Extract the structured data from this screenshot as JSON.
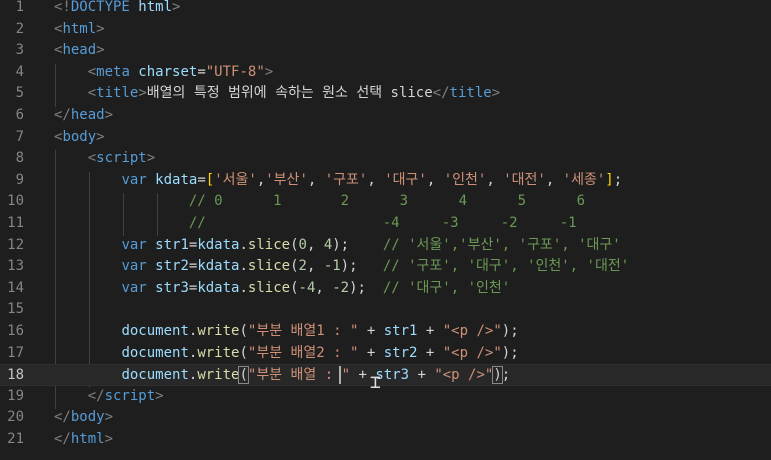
{
  "editor": {
    "current_line": 18,
    "lines": [
      {
        "n": "1",
        "segs": [
          [
            "<!",
            "t-punct"
          ],
          [
            "DOCTYPE",
            "t-tag"
          ],
          [
            " html",
            "t-attr"
          ],
          [
            ">",
            "t-punct"
          ]
        ]
      },
      {
        "n": "2",
        "segs": [
          [
            "<",
            "t-punct"
          ],
          [
            "html",
            "t-tag"
          ],
          [
            ">",
            "t-punct"
          ]
        ]
      },
      {
        "n": "3",
        "segs": [
          [
            "<",
            "t-punct"
          ],
          [
            "head",
            "t-tag"
          ],
          [
            ">",
            "t-punct"
          ]
        ]
      },
      {
        "n": "4",
        "segs": [
          [
            "    ",
            "t-text"
          ],
          [
            "<",
            "t-punct"
          ],
          [
            "meta",
            "t-tag"
          ],
          [
            " charset",
            "t-attr"
          ],
          [
            "=",
            "t-text"
          ],
          [
            "\"UTF-8\"",
            "t-str"
          ],
          [
            ">",
            "t-punct"
          ]
        ]
      },
      {
        "n": "5",
        "segs": [
          [
            "    ",
            "t-text"
          ],
          [
            "<",
            "t-punct"
          ],
          [
            "title",
            "t-tag"
          ],
          [
            ">",
            "t-punct"
          ],
          [
            "배열의 특정 범위에 속하는 원소 선택 slice",
            "t-text"
          ],
          [
            "</",
            "t-punct"
          ],
          [
            "title",
            "t-tag"
          ],
          [
            ">",
            "t-punct"
          ]
        ]
      },
      {
        "n": "6",
        "segs": [
          [
            "</",
            "t-punct"
          ],
          [
            "head",
            "t-tag"
          ],
          [
            ">",
            "t-punct"
          ]
        ]
      },
      {
        "n": "7",
        "segs": [
          [
            "<",
            "t-punct"
          ],
          [
            "body",
            "t-tag"
          ],
          [
            ">",
            "t-punct"
          ]
        ]
      },
      {
        "n": "8",
        "segs": [
          [
            "    ",
            "t-text"
          ],
          [
            "<",
            "t-punct"
          ],
          [
            "script",
            "t-tag"
          ],
          [
            ">",
            "t-punct"
          ]
        ]
      },
      {
        "n": "9",
        "segs": [
          [
            "        ",
            "t-text"
          ],
          [
            "var",
            "t-kw"
          ],
          [
            " kdata",
            "t-var"
          ],
          [
            "=",
            "t-text"
          ],
          [
            "[",
            "t-bracket"
          ],
          [
            "'서울'",
            "t-str"
          ],
          [
            ",",
            "t-text"
          ],
          [
            "'부산'",
            "t-str"
          ],
          [
            ", ",
            "t-text"
          ],
          [
            "'구포'",
            "t-str"
          ],
          [
            ", ",
            "t-text"
          ],
          [
            "'대구'",
            "t-str"
          ],
          [
            ", ",
            "t-text"
          ],
          [
            "'인천'",
            "t-str"
          ],
          [
            ", ",
            "t-text"
          ],
          [
            "'대전'",
            "t-str"
          ],
          [
            ", ",
            "t-text"
          ],
          [
            "'세종'",
            "t-str"
          ],
          [
            "]",
            "t-bracket"
          ],
          [
            ";",
            "t-text"
          ]
        ]
      },
      {
        "n": "10",
        "segs": [
          [
            "                ",
            "t-text"
          ],
          [
            "// 0      1       2      3      4      5      6",
            "t-cmt"
          ]
        ]
      },
      {
        "n": "11",
        "segs": [
          [
            "                ",
            "t-text"
          ],
          [
            "//                     -4     -3     -2     -1",
            "t-cmt"
          ]
        ]
      },
      {
        "n": "12",
        "segs": [
          [
            "        ",
            "t-text"
          ],
          [
            "var",
            "t-kw"
          ],
          [
            " str1",
            "t-var"
          ],
          [
            "=",
            "t-text"
          ],
          [
            "kdata",
            "t-var"
          ],
          [
            ".",
            "t-text"
          ],
          [
            "slice",
            "t-fn"
          ],
          [
            "(",
            "t-text"
          ],
          [
            "0",
            "t-num"
          ],
          [
            ", ",
            "t-text"
          ],
          [
            "4",
            "t-num"
          ],
          [
            ");",
            "t-text"
          ],
          [
            "    ",
            "t-text"
          ],
          [
            "// '서울','부산', '구포', '대구'",
            "t-cmt"
          ]
        ]
      },
      {
        "n": "13",
        "segs": [
          [
            "        ",
            "t-text"
          ],
          [
            "var",
            "t-kw"
          ],
          [
            " str2",
            "t-var"
          ],
          [
            "=",
            "t-text"
          ],
          [
            "kdata",
            "t-var"
          ],
          [
            ".",
            "t-text"
          ],
          [
            "slice",
            "t-fn"
          ],
          [
            "(",
            "t-text"
          ],
          [
            "2",
            "t-num"
          ],
          [
            ", ",
            "t-text"
          ],
          [
            "-1",
            "t-num"
          ],
          [
            ");",
            "t-text"
          ],
          [
            "   ",
            "t-text"
          ],
          [
            "// '구포', '대구', '인천', '대전'",
            "t-cmt"
          ]
        ]
      },
      {
        "n": "14",
        "segs": [
          [
            "        ",
            "t-text"
          ],
          [
            "var",
            "t-kw"
          ],
          [
            " str3",
            "t-var"
          ],
          [
            "=",
            "t-text"
          ],
          [
            "kdata",
            "t-var"
          ],
          [
            ".",
            "t-text"
          ],
          [
            "slice",
            "t-fn"
          ],
          [
            "(",
            "t-text"
          ],
          [
            "-4",
            "t-num"
          ],
          [
            ", ",
            "t-text"
          ],
          [
            "-2",
            "t-num"
          ],
          [
            ");",
            "t-text"
          ],
          [
            "  ",
            "t-text"
          ],
          [
            "// '대구', '인천'",
            "t-cmt"
          ]
        ]
      },
      {
        "n": "15",
        "segs": []
      },
      {
        "n": "16",
        "segs": [
          [
            "        ",
            "t-text"
          ],
          [
            "document",
            "t-var"
          ],
          [
            ".",
            "t-text"
          ],
          [
            "write",
            "t-fn"
          ],
          [
            "(",
            "t-text"
          ],
          [
            "\"부분 배열1 : \"",
            "t-str"
          ],
          [
            " + ",
            "t-text"
          ],
          [
            "str1",
            "t-var"
          ],
          [
            " + ",
            "t-text"
          ],
          [
            "\"<p />\"",
            "t-str"
          ],
          [
            ");",
            "t-text"
          ]
        ]
      },
      {
        "n": "17",
        "segs": [
          [
            "        ",
            "t-text"
          ],
          [
            "document",
            "t-var"
          ],
          [
            ".",
            "t-text"
          ],
          [
            "write",
            "t-fn"
          ],
          [
            "(",
            "t-text"
          ],
          [
            "\"부분 배열2 : \"",
            "t-str"
          ],
          [
            " + ",
            "t-text"
          ],
          [
            "str2",
            "t-var"
          ],
          [
            " + ",
            "t-text"
          ],
          [
            "\"<p />\"",
            "t-str"
          ],
          [
            ");",
            "t-text"
          ]
        ]
      },
      {
        "n": "18",
        "segs": [
          [
            "        ",
            "t-text"
          ],
          [
            "document",
            "t-var"
          ],
          [
            ".",
            "t-text"
          ],
          [
            "write",
            "t-fn"
          ],
          [
            "(",
            "t-white bm"
          ],
          [
            "\"부분 배열",
            "t-str"
          ],
          [
            " : \"",
            "t-str"
          ],
          [
            " + ",
            "t-text"
          ],
          [
            "str3",
            "t-var"
          ],
          [
            " + ",
            "t-text"
          ],
          [
            "\"<p />\"",
            "t-str"
          ],
          [
            ")",
            "t-white bm"
          ],
          [
            ";",
            "t-text"
          ]
        ]
      },
      {
        "n": "19",
        "segs": [
          [
            "    ",
            "t-text"
          ],
          [
            "</",
            "t-punct"
          ],
          [
            "script",
            "t-tag"
          ],
          [
            ">",
            "t-punct"
          ]
        ]
      },
      {
        "n": "20",
        "segs": [
          [
            "</",
            "t-punct"
          ],
          [
            "body",
            "t-tag"
          ],
          [
            ">",
            "t-punct"
          ]
        ]
      },
      {
        "n": "21",
        "segs": [
          [
            "</",
            "t-punct"
          ],
          [
            "html",
            "t-tag"
          ],
          [
            ">",
            "t-punct"
          ]
        ]
      }
    ]
  }
}
